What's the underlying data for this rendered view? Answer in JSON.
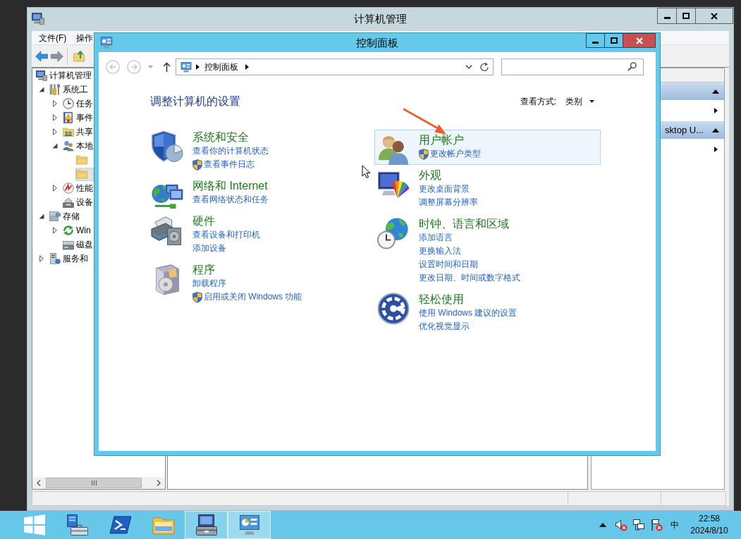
{
  "background_window": {
    "title": "计算机管理",
    "menu": [
      "文件(F)",
      "操作"
    ],
    "tree": [
      {
        "label": "计算机管理",
        "selected": false,
        "children": [
          {
            "label": "系统工",
            "expanded": true,
            "selected": false,
            "children": [
              {
                "label": "任务",
                "expanded": false,
                "selected": false
              },
              {
                "label": "事件",
                "expanded": false,
                "selected": false
              },
              {
                "label": "共享",
                "expanded": false,
                "selected": false
              },
              {
                "label": "本地",
                "expanded": true,
                "selected": false,
                "children": [
                  {
                    "selected": false
                  },
                  {
                    "selected": true
                  }
                ]
              },
              {
                "label": "性能",
                "expanded": false,
                "selected": false
              },
              {
                "label": "设备",
                "selected": false
              }
            ]
          },
          {
            "label": "存储",
            "expanded": true,
            "selected": false,
            "children": [
              {
                "label": "Win",
                "expanded": false,
                "selected": false
              },
              {
                "label": "磁盘",
                "selected": false
              }
            ]
          },
          {
            "label": "服务和",
            "expanded": false,
            "selected": false
          }
        ]
      }
    ],
    "actions": [
      {
        "expanded": true,
        "rows": [
          {
            "submenu": true
          }
        ]
      },
      {
        "title": "sktop U...",
        "expanded": true,
        "rows": [
          {
            "submenu": true
          }
        ]
      }
    ]
  },
  "control_panel": {
    "title": "控制面板",
    "back": {
      "disabled": true
    },
    "forward": {
      "disabled": true
    },
    "breadcrumb": [
      "控制面板"
    ],
    "heading": "调整计算机的设置",
    "view_by": {
      "label": "查看方式:",
      "value": "类别"
    },
    "columns": [
      {
        "categories": [
          {
            "title": "系统和安全",
            "highlighted": false,
            "links": [
              {
                "text": "查看你的计算机状态",
                "shield": false
              },
              {
                "text": "查看事件日志",
                "shield": true
              }
            ]
          },
          {
            "title": "网络和 Internet",
            "highlighted": false,
            "links": [
              {
                "text": "查看网络状态和任务",
                "shield": false
              }
            ]
          },
          {
            "title": "硬件",
            "highlighted": false,
            "links": [
              {
                "text": "查看设备和打印机",
                "shield": false
              },
              {
                "text": "添加设备",
                "shield": false
              }
            ]
          },
          {
            "title": "程序",
            "highlighted": false,
            "links": [
              {
                "text": "卸载程序",
                "shield": false
              },
              {
                "text": "启用或关闭 Windows 功能",
                "shield": true
              }
            ]
          }
        ]
      },
      {
        "categories": [
          {
            "title": "用户帐户",
            "highlighted": true,
            "links": [
              {
                "text": "更改帐户类型",
                "shield": true
              }
            ]
          },
          {
            "title": "外观",
            "highlighted": false,
            "links": [
              {
                "text": "更改桌面背景",
                "shield": false
              },
              {
                "text": "调整屏幕分辨率",
                "shield": false
              }
            ]
          },
          {
            "title": "时钟、语言和区域",
            "highlighted": false,
            "links": [
              {
                "text": "添加语言",
                "shield": false
              },
              {
                "text": "更换输入法",
                "shield": false
              },
              {
                "text": "设置时间和日期",
                "shield": false
              },
              {
                "text": "更改日期、时间或数字格式",
                "shield": false
              }
            ]
          },
          {
            "title": "轻松使用",
            "highlighted": false,
            "links": [
              {
                "text": "使用 Windows 建议的设置",
                "shield": false
              },
              {
                "text": "优化视觉显示",
                "shield": false
              }
            ]
          }
        ]
      }
    ]
  },
  "taskbar": {
    "apps": [
      {
        "kind": "start",
        "open": false,
        "selected": false
      },
      {
        "kind": "server",
        "open": false,
        "selected": false
      },
      {
        "kind": "shell",
        "open": false,
        "selected": false
      },
      {
        "kind": "files",
        "open": false,
        "selected": false
      },
      {
        "kind": "management",
        "open": true,
        "selected": false
      },
      {
        "kind": "settings",
        "open": true,
        "selected": true
      }
    ],
    "tray": {
      "ime": "中",
      "time": "22:58",
      "date": "2024/8/10"
    }
  }
}
